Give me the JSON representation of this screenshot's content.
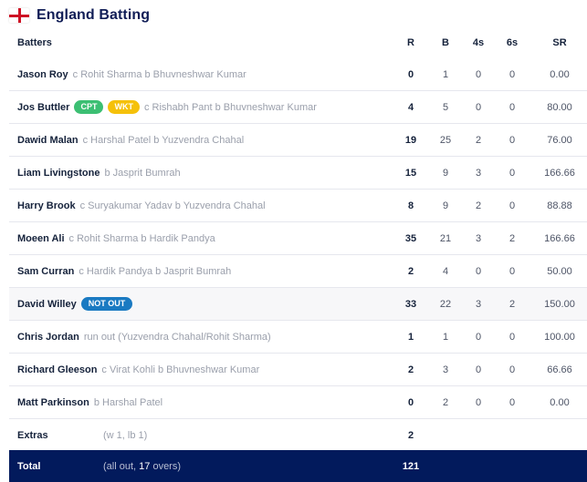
{
  "header": {
    "title": "England Batting",
    "flag_icon": "england-flag-icon"
  },
  "columns": {
    "batters": "Batters",
    "runs": "R",
    "balls": "B",
    "fours": "4s",
    "sixes": "6s",
    "strike_rate": "SR"
  },
  "batters": [
    {
      "name": "Jason Roy",
      "badges": [],
      "dismissal": "c Rohit Sharma b Bhuvneshwar Kumar",
      "r": "0",
      "b": "1",
      "fours": "0",
      "sixes": "0",
      "sr": "0.00"
    },
    {
      "name": "Jos Buttler",
      "badges": [
        "CPT",
        "WKT"
      ],
      "dismissal": "c Rishabh Pant b Bhuvneshwar Kumar",
      "r": "4",
      "b": "5",
      "fours": "0",
      "sixes": "0",
      "sr": "80.00"
    },
    {
      "name": "Dawid Malan",
      "badges": [],
      "dismissal": "c Harshal Patel b Yuzvendra Chahal",
      "r": "19",
      "b": "25",
      "fours": "2",
      "sixes": "0",
      "sr": "76.00"
    },
    {
      "name": "Liam Livingstone",
      "badges": [],
      "dismissal": "b Jasprit Bumrah",
      "r": "15",
      "b": "9",
      "fours": "3",
      "sixes": "0",
      "sr": "166.66"
    },
    {
      "name": "Harry Brook",
      "badges": [],
      "dismissal": "c Suryakumar Yadav b Yuzvendra Chahal",
      "r": "8",
      "b": "9",
      "fours": "2",
      "sixes": "0",
      "sr": "88.88"
    },
    {
      "name": "Moeen Ali",
      "badges": [],
      "dismissal": "c Rohit Sharma b Hardik Pandya",
      "r": "35",
      "b": "21",
      "fours": "3",
      "sixes": "2",
      "sr": "166.66"
    },
    {
      "name": "Sam Curran",
      "badges": [],
      "dismissal": "c Hardik Pandya b Jasprit Bumrah",
      "r": "2",
      "b": "4",
      "fours": "0",
      "sixes": "0",
      "sr": "50.00"
    },
    {
      "name": "David Willey",
      "badges": [
        "NOT OUT"
      ],
      "dismissal": "",
      "r": "33",
      "b": "22",
      "fours": "3",
      "sixes": "2",
      "sr": "150.00"
    },
    {
      "name": "Chris Jordan",
      "badges": [],
      "dismissal": "run out (Yuzvendra Chahal/Rohit Sharma)",
      "r": "1",
      "b": "1",
      "fours": "0",
      "sixes": "0",
      "sr": "100.00"
    },
    {
      "name": "Richard Gleeson",
      "badges": [],
      "dismissal": "c Virat Kohli b Bhuvneshwar Kumar",
      "r": "2",
      "b": "3",
      "fours": "0",
      "sixes": "0",
      "sr": "66.66"
    },
    {
      "name": "Matt Parkinson",
      "badges": [],
      "dismissal": "b Harshal Patel",
      "r": "0",
      "b": "2",
      "fours": "0",
      "sixes": "0",
      "sr": "0.00"
    }
  ],
  "extras": {
    "label": "Extras",
    "detail": "(w 1, lb 1)",
    "runs": "2"
  },
  "total": {
    "label": "Total",
    "detail_prefix": "(all out, ",
    "overs": "17",
    "detail_suffix": " overs)",
    "runs": "121"
  },
  "colors": {
    "total_bg": "#021a5c",
    "cpt_badge": "#3cbf73",
    "wkt_badge": "#f5c10a",
    "not_out_badge": "#1a7ac2",
    "flag_cross": "#ce1124"
  }
}
